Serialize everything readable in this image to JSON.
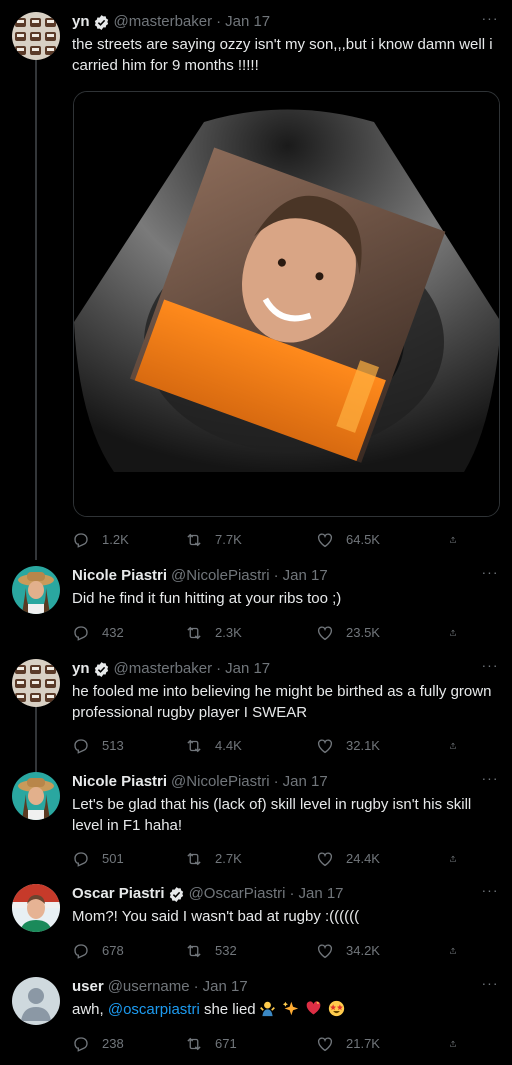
{
  "tweets": [
    {
      "name": "yn",
      "verified": true,
      "handle": "@masterbaker",
      "time": "Jan 17",
      "text": "the streets are saying ozzy isn't my son,,,but i know damn well i carried him for 9 months !!!!!",
      "stats": {
        "replies": "1.2K",
        "retweets": "7.7K",
        "likes": "64.5K"
      }
    },
    {
      "name": "Nicole Piastri",
      "verified": false,
      "handle": "@NicolePiastri",
      "time": "Jan 17",
      "text": "Did he find it fun hitting at your ribs too ;)",
      "stats": {
        "replies": "432",
        "retweets": "2.3K",
        "likes": "23.5K"
      }
    },
    {
      "name": "yn",
      "verified": true,
      "handle": "@masterbaker",
      "time": "Jan 17",
      "text": "he fooled me into believing he might be birthed as a fully grown professional rugby player I SWEAR",
      "stats": {
        "replies": "513",
        "retweets": "4.4K",
        "likes": "32.1K"
      }
    },
    {
      "name": "Nicole Piastri",
      "verified": false,
      "handle": "@NicolePiastri",
      "time": "Jan 17",
      "text": "Let's be glad that his (lack of) skill level in rugby isn't his skill level in F1 haha!",
      "stats": {
        "replies": "501",
        "retweets": "2.7K",
        "likes": "24.4K"
      }
    },
    {
      "name": "Oscar Piastri",
      "verified": true,
      "handle": "@OscarPiastri",
      "time": "Jan 17",
      "text": "Mom?! You said I wasn't bad at rugby :((((((",
      "stats": {
        "replies": "678",
        "retweets": "532",
        "likes": "34.2K"
      }
    },
    {
      "name": "user",
      "verified": false,
      "handle": "@username",
      "time": "Jan 17",
      "text_prefix": "awh, ",
      "mention": "@oscarpiastri",
      "text_suffix": " she lied",
      "emoji": [
        "man-shrugging",
        "sparkles",
        "heart-exclamation",
        "star-struck"
      ],
      "stats": {
        "replies": "238",
        "retweets": "671",
        "likes": "21.7K"
      }
    }
  ],
  "separator": "·",
  "more_icon": "···",
  "colors": {
    "background": "#000000",
    "text": "#e7e9ea",
    "secondary": "#71767b",
    "accent": "#1d9bf0",
    "line": "#333639"
  },
  "icons": [
    "reply-icon",
    "retweet-icon",
    "like-icon",
    "share-icon",
    "verified-icon",
    "more-icon"
  ]
}
